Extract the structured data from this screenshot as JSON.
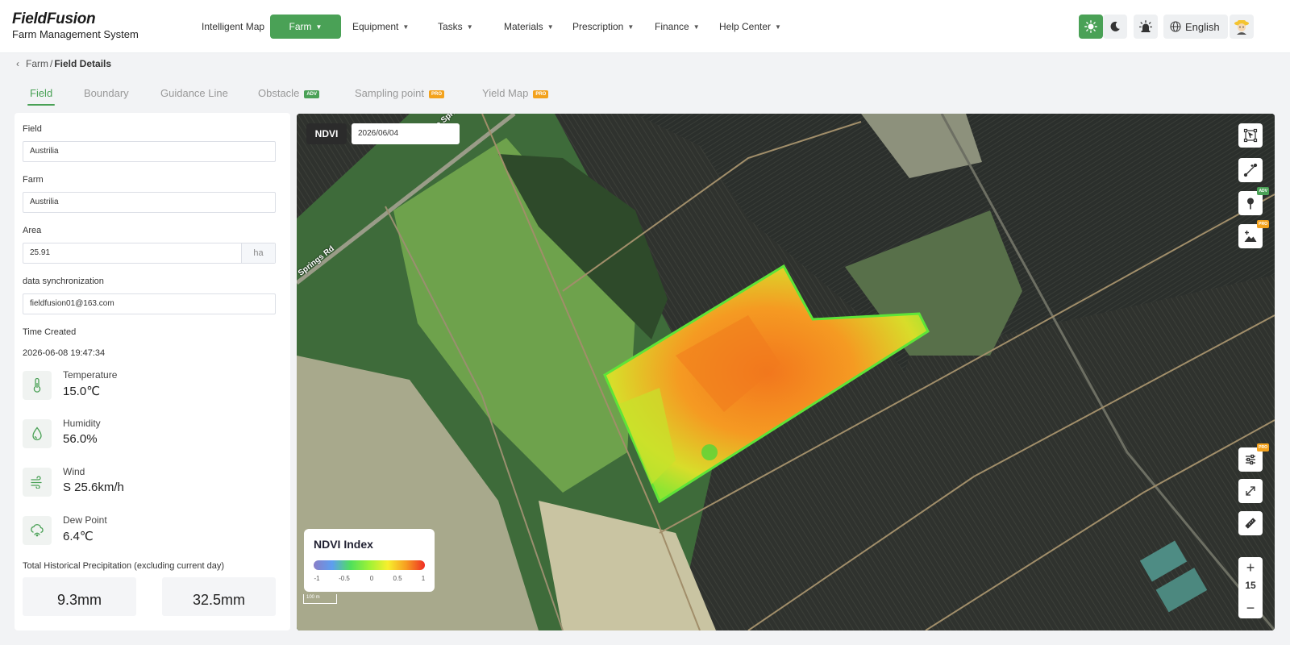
{
  "app": {
    "name": "FieldFusion",
    "subtitle": "Farm Management System"
  },
  "nav": [
    {
      "label": "Intelligent Map",
      "dropdown": false
    },
    {
      "label": "Farm",
      "dropdown": true,
      "active": true
    },
    {
      "label": "Equipment",
      "dropdown": true
    },
    {
      "label": "Tasks",
      "dropdown": true
    },
    {
      "label": "Materials",
      "dropdown": true
    },
    {
      "label": "Prescription",
      "dropdown": true
    },
    {
      "label": "Finance",
      "dropdown": true
    },
    {
      "label": "Help Center",
      "dropdown": true
    }
  ],
  "header": {
    "language": "English"
  },
  "breadcrumb": {
    "parent": "Farm",
    "separator": "/",
    "current": "Field Details"
  },
  "tabs": [
    {
      "label": "Field",
      "badge": "",
      "active": true
    },
    {
      "label": "Boundary",
      "badge": ""
    },
    {
      "label": "Guidance Line",
      "badge": ""
    },
    {
      "label": "Obstacle",
      "badge": "ADV"
    },
    {
      "label": "Sampling point",
      "badge": "PRO"
    },
    {
      "label": "Yield Map",
      "badge": "PRO"
    }
  ],
  "details": {
    "field_label": "Field",
    "field_value": "Austrilia",
    "farm_label": "Farm",
    "farm_value": "Austrilia",
    "area_label": "Area",
    "area_value": "25.91",
    "area_unit": "ha",
    "sync_label": "data synchronization",
    "sync_value": "fieldfusion01@163.com",
    "created_label": "Time Created",
    "created_value": "2026-06-08 19:47:34"
  },
  "weather": [
    {
      "icon": "thermometer-icon",
      "label": "Temperature",
      "value": "15.0℃"
    },
    {
      "icon": "droplet-icon",
      "label": "Humidity",
      "value": "56.0%"
    },
    {
      "icon": "wind-icon",
      "label": "Wind",
      "value": "S 25.6km/h"
    },
    {
      "icon": "dew-point-icon",
      "label": "Dew Point",
      "value": "6.4℃"
    }
  ],
  "precipitation": {
    "label": "Total Historical Precipitation (excluding current day)",
    "values": [
      "9.3mm",
      "32.5mm"
    ]
  },
  "map": {
    "layer": "NDVI",
    "date": "2026/06/04",
    "road_labels": [
      "Orange Springs Rd",
      "Springs Rd"
    ],
    "zoom_level": "15",
    "scale": "100 m",
    "legend": {
      "title": "NDVI Index",
      "ticks": [
        "-1",
        "-0.5",
        "0",
        "0.5",
        "1"
      ]
    },
    "tool_badges": {
      "marker": "ADV",
      "elevation": "PRO",
      "settings": "PRO"
    },
    "colors": {
      "brand": "#4aa156",
      "ndvi_low": "#8a7ec7",
      "ndvi_mid": "#50e05b",
      "ndvi_high": "#ef2d24"
    }
  }
}
